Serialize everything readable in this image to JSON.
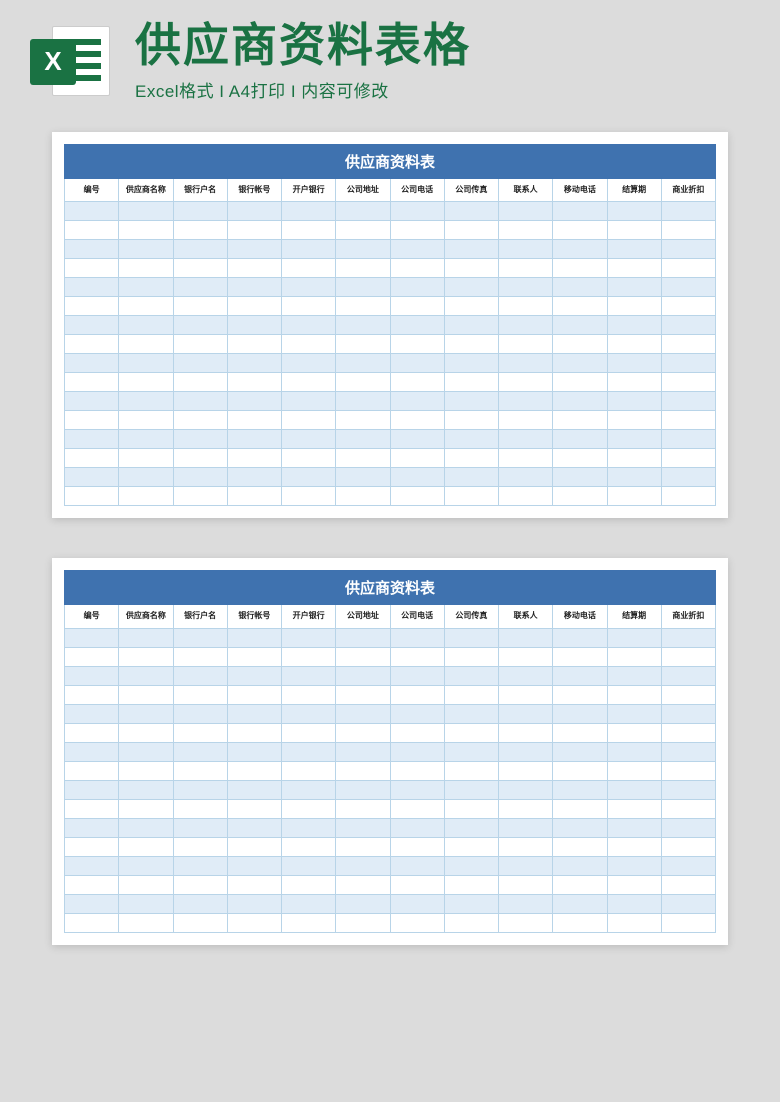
{
  "header": {
    "icon_letter": "X",
    "title": "供应商资料表格",
    "subtitle_parts": [
      "Excel格式",
      "A4打印",
      "内容可修改"
    ],
    "subtitle_separator": " I "
  },
  "sheet": {
    "title": "供应商资料表",
    "columns": [
      "编号",
      "供应商名称",
      "银行户名",
      "银行帐号",
      "开户银行",
      "公司地址",
      "公司电话",
      "公司传真",
      "联系人",
      "移动电话",
      "结算期",
      "商业折扣"
    ],
    "row_count": 16
  }
}
